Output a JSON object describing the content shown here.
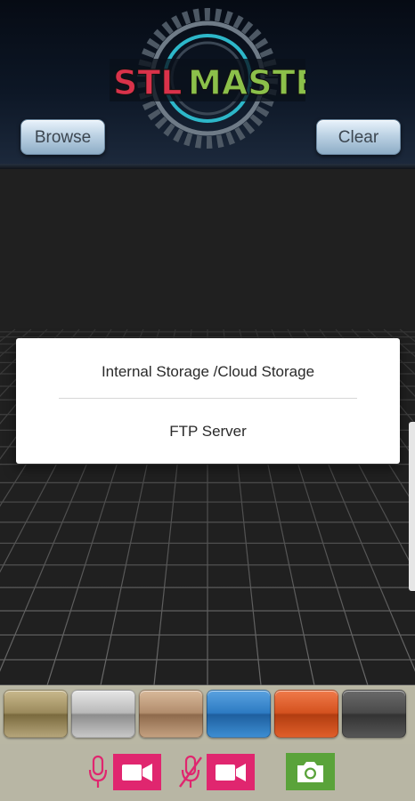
{
  "app": {
    "logo_text_1": "STL",
    "logo_text_2": "MASTER"
  },
  "toolbar": {
    "browse_label": "Browse",
    "clear_label": "Clear"
  },
  "dialog": {
    "options": [
      {
        "label": "Internal Storage /Cloud Storage"
      },
      {
        "label": "FTP Server"
      }
    ]
  },
  "materials": [
    {
      "name": "gold",
      "color": "#b3a06f"
    },
    {
      "name": "silver",
      "color": "#b0b0b0"
    },
    {
      "name": "bronze",
      "color": "#a98363"
    },
    {
      "name": "blue",
      "color": "#2f7dc5"
    },
    {
      "name": "orange",
      "color": "#d2521f"
    },
    {
      "name": "dark-gray",
      "color": "#4a4a4a"
    }
  ],
  "controls": {
    "icons": [
      "microphone-icon",
      "video-camera-icon",
      "microphone-muted-icon",
      "video-camera-icon",
      "camera-icon"
    ],
    "accent_pink": "#e0266f",
    "accent_green": "#5aa33a"
  }
}
